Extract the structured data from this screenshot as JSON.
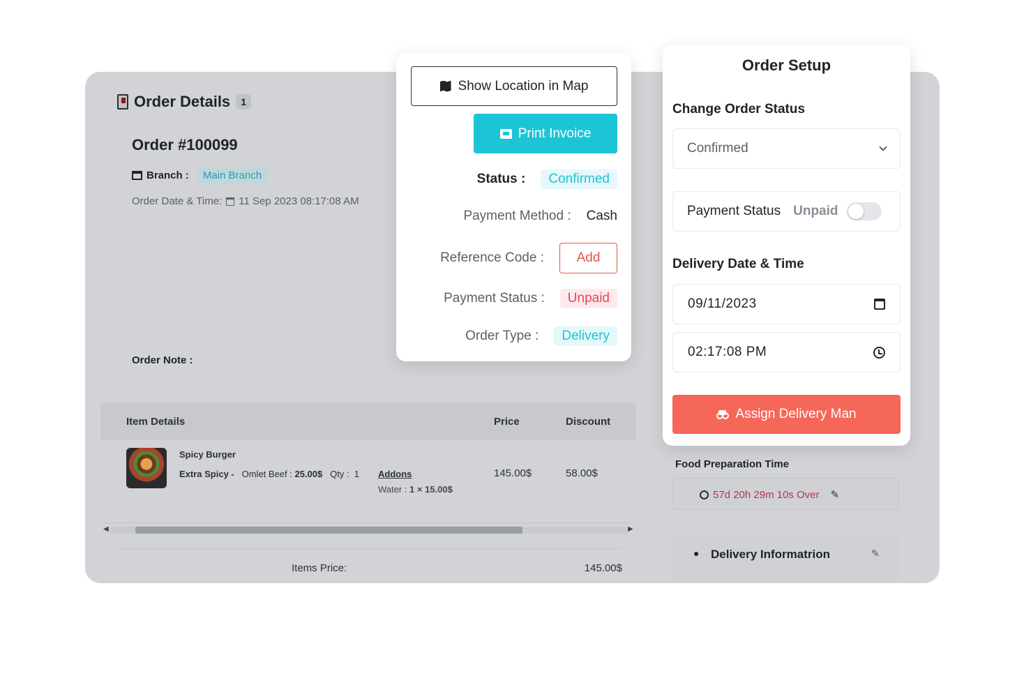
{
  "order_details": {
    "title": "Order Details",
    "count": "1",
    "order_number": "Order #100099",
    "branch_label": "Branch :",
    "branch_value": "Main Branch",
    "date_label": "Order Date & Time:",
    "date_value": "11 Sep 2023 08:17:08 AM",
    "order_note_label": "Order Note :"
  },
  "items_table": {
    "headers": {
      "item_details": "Item Details",
      "price": "Price",
      "discount": "Discount"
    },
    "rows": [
      {
        "name": "Spicy Burger",
        "variation_label": "Extra Spicy -",
        "variation_value": "Omlet Beef :",
        "variation_price": "25.00$",
        "qty_label": "Qty :",
        "qty_value": "1",
        "addons_label": "Addons",
        "addon_line_label": "Water :",
        "addon_line_value": "1 × 15.00$",
        "price": "145.00$",
        "discount": "58.00$"
      }
    ],
    "items_price_label": "Items Price:",
    "items_price_value": "145.00$"
  },
  "food_prep": {
    "title": "Food Preparation Time",
    "timer": "57d 20h 29m 10s Over"
  },
  "delivery_info": {
    "title": "Delivery Informatrion"
  },
  "status_card": {
    "show_map_label": "Show Location in Map",
    "print_label": "Print Invoice",
    "status_label": "Status :",
    "status_value": "Confirmed",
    "payment_method_label": "Payment Method :",
    "payment_method_value": "Cash",
    "reference_label": "Reference Code :",
    "reference_button": "Add",
    "payment_status_label": "Payment Status :",
    "payment_status_value": "Unpaid",
    "order_type_label": "Order Type :",
    "order_type_value": "Delivery"
  },
  "order_setup": {
    "title": "Order Setup",
    "change_status_label": "Change Order Status",
    "status_selected": "Confirmed",
    "payment_status_label": "Payment Status",
    "payment_status_value": "Unpaid",
    "payment_toggle_on": false,
    "delivery_label": "Delivery Date & Time",
    "delivery_date": "09/11/2023",
    "delivery_time": "02:17:08 PM",
    "assign_label": "Assign Delivery Man"
  },
  "colors": {
    "teal": "#1dc4d6",
    "coral": "#f56759",
    "danger": "#e0475b"
  }
}
